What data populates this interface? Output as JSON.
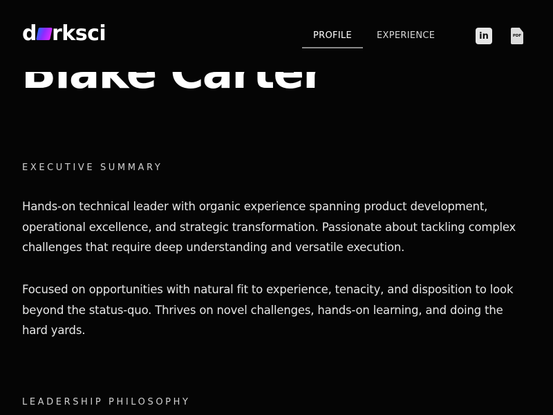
{
  "brand": {
    "logo_prefix": "d",
    "logo_suffix": "rksci"
  },
  "header": {
    "tabs": [
      {
        "label": "PROFILE",
        "active": true
      },
      {
        "label": "EXPERIENCE",
        "active": false
      }
    ],
    "linkedin_icon_text": "in",
    "pdf_icon_text": "PDF"
  },
  "hero": {
    "name": "Blake Carter"
  },
  "sections": {
    "summary": {
      "label": "EXECUTIVE SUMMARY",
      "paragraphs": [
        "Hands-on technical leader with organic experience spanning product development, operational excellence, and strategic transformation. Passionate about tackling complex challenges that require deep understanding and versatile execution.",
        "Focused on opportunities with natural fit to experience, tenacity, and disposition to look beyond the status-quo. Thrives on novel challenges, hands-on learning, and doing the hard yards."
      ]
    },
    "philosophy": {
      "label": "LEADERSHIP PHILOSOPHY"
    }
  },
  "colors": {
    "background": "#050505",
    "text": "#f2f2f2",
    "logo_gradient": [
      "#2a6cff",
      "#8a2cff",
      "#e02cff"
    ]
  }
}
